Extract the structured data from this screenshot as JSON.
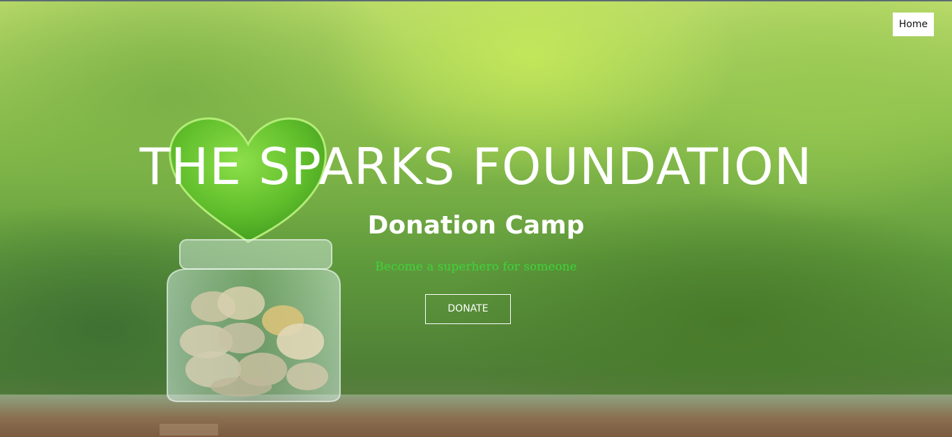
{
  "nav": {
    "home_label": "Home"
  },
  "hero": {
    "title": "THE SPARKS FOUNDATION",
    "subtitle": "Donation Camp",
    "tagline": "Become a superhero for someone",
    "donate_label": "DONATE",
    "image_description_icon": "heart-jar-of-coins-image"
  },
  "colors": {
    "tagline": "#3fd43b",
    "title": "#ffffff",
    "button_border": "#ffffff"
  }
}
